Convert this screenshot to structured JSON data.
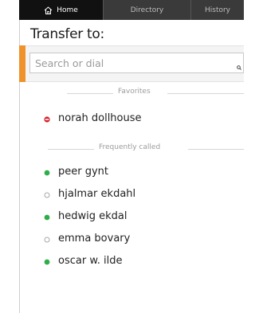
{
  "tabs": {
    "home": "Home",
    "directory": "Directory",
    "history": "History"
  },
  "title": "Transfer to:",
  "search": {
    "placeholder": "Search or dial",
    "value": ""
  },
  "sections": {
    "favorites": "Favorites",
    "frequent": "Frequently called"
  },
  "favorites": [
    {
      "name": "norah dollhouse",
      "status": "busy"
    }
  ],
  "frequent": [
    {
      "name": "peer gynt",
      "status": "available"
    },
    {
      "name": "hjalmar ekdahl",
      "status": "offline"
    },
    {
      "name": "hedwig ekdal",
      "status": "available"
    },
    {
      "name": "emma bovary",
      "status": "offline"
    },
    {
      "name": "oscar w. ilde",
      "status": "available"
    }
  ],
  "colors": {
    "accent": "#f0922c",
    "available": "#2eae4a",
    "busy": "#d6202a",
    "offline": "#a8a8a8",
    "tab_bar": "#2b2b2b"
  },
  "icons": {
    "home_tab": "home-icon",
    "search": "search-icon",
    "available": "status-available-icon",
    "busy": "status-busy-icon",
    "offline": "status-offline-icon"
  }
}
